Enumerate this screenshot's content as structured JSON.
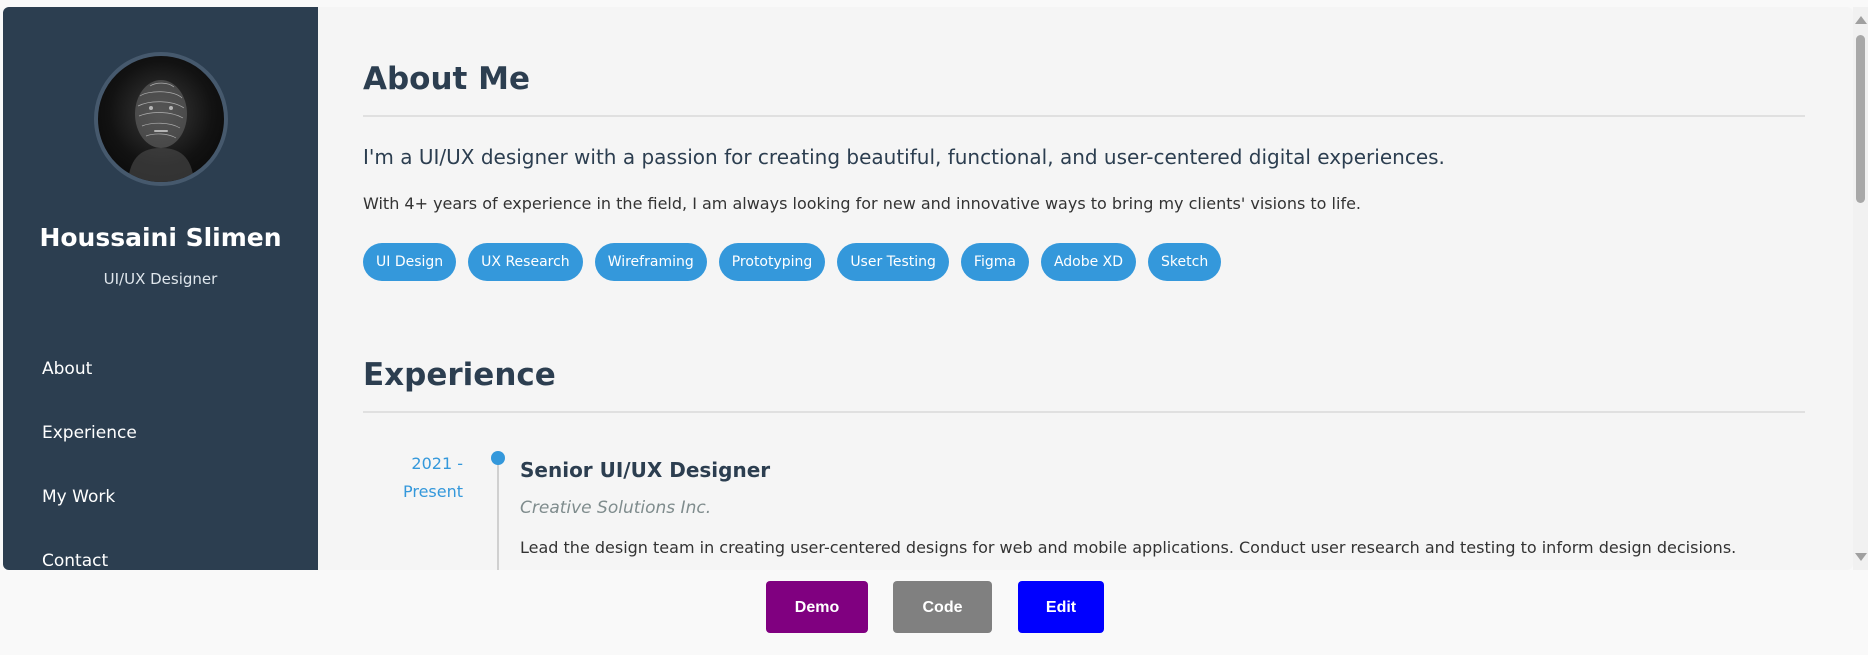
{
  "sidebar": {
    "name": "Houssaini Slimen",
    "role": "UI/UX Designer",
    "nav": [
      "About",
      "Experience",
      "My Work",
      "Contact"
    ]
  },
  "about": {
    "heading": "About Me",
    "lead": "I'm a UI/UX designer with a passion for creating beautiful, functional, and user-centered digital experiences.",
    "paragraph": "With 4+ years of experience in the field, I am always looking for new and innovative ways to bring my clients' visions to life.",
    "skills": [
      "UI Design",
      "UX Research",
      "Wireframing",
      "Prototyping",
      "User Testing",
      "Figma",
      "Adobe XD",
      "Sketch"
    ]
  },
  "experience": {
    "heading": "Experience",
    "items": [
      {
        "date_line1": "2021 -",
        "date_line2": "Present",
        "title": "Senior UI/UX Designer",
        "company": "Creative Solutions Inc.",
        "description": "Lead the design team in creating user-centered designs for web and mobile applications. Conduct user research and testing to inform design decisions."
      }
    ]
  },
  "bottom_bar": {
    "demo": "Demo",
    "code": "Code",
    "edit": "Edit"
  },
  "colors": {
    "sidebar_bg": "#2c3e50",
    "accent": "#3498db",
    "demo_btn": "#800080",
    "code_btn": "#808080",
    "edit_btn": "#0000ff"
  }
}
